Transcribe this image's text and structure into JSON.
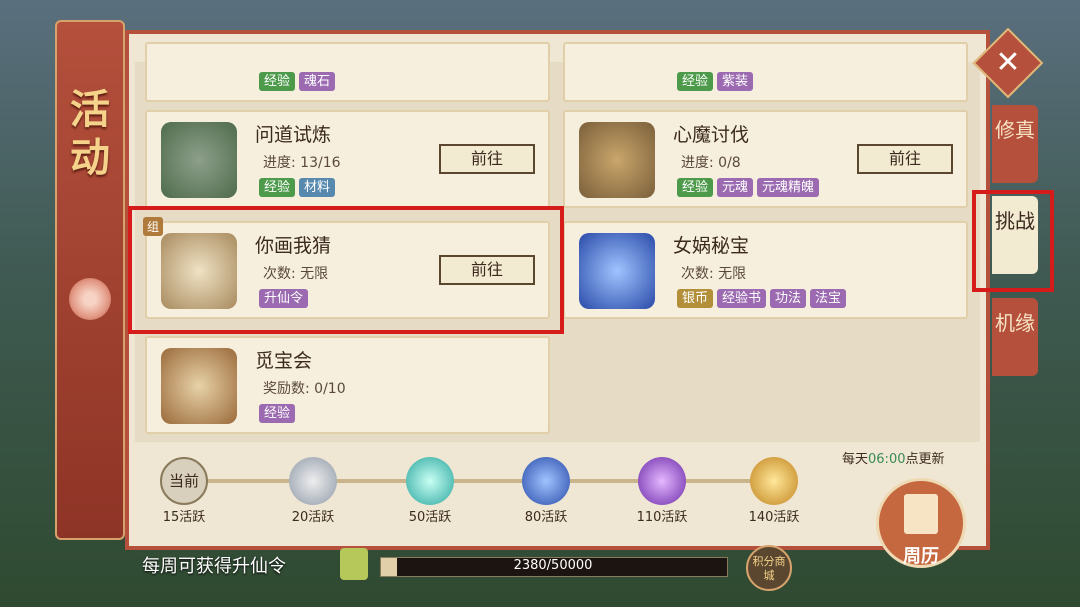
{
  "banner": {
    "title": "活动"
  },
  "right_tabs": [
    {
      "label": "修真",
      "active": false
    },
    {
      "label": "挑战",
      "active": true
    },
    {
      "label": "机缘",
      "active": false
    }
  ],
  "cards": [
    {
      "tags": [
        {
          "text": "经验",
          "color": "green"
        },
        {
          "text": "魂石",
          "color": "purple"
        }
      ]
    },
    {
      "tags": [
        {
          "text": "经验",
          "color": "green"
        },
        {
          "text": "紫装",
          "color": "purple"
        }
      ]
    },
    {
      "name": "问道试炼",
      "sub": "进度: 13/16",
      "button": "前往",
      "tags": [
        {
          "text": "经验",
          "color": "green"
        },
        {
          "text": "材料",
          "color": "blue"
        }
      ]
    },
    {
      "name": "心魔讨伐",
      "sub": "进度: 0/8",
      "button": "前往",
      "tags": [
        {
          "text": "经验",
          "color": "green"
        },
        {
          "text": "元魂",
          "color": "purple"
        },
        {
          "text": "元魂精魄",
          "color": "purple"
        }
      ]
    },
    {
      "name": "你画我猜",
      "sub": "次数: 无限",
      "button": "前往",
      "badge": "组",
      "tags": [
        {
          "text": "升仙令",
          "color": "purple"
        }
      ]
    },
    {
      "name": "女娲秘宝",
      "sub": "次数: 无限",
      "tags": [
        {
          "text": "银币",
          "color": "gold"
        },
        {
          "text": "经验书",
          "color": "purple"
        },
        {
          "text": "功法",
          "color": "purple"
        },
        {
          "text": "法宝",
          "color": "purple"
        }
      ]
    },
    {
      "name": "觅宝会",
      "sub": "奖励数: 0/10",
      "tags": [
        {
          "text": "经验",
          "color": "purple"
        }
      ]
    }
  ],
  "progress": {
    "current_label": "当前",
    "nodes": [
      "15活跃",
      "20活跃",
      "50活跃",
      "80活跃",
      "110活跃",
      "140活跃"
    ]
  },
  "update": {
    "prefix": "每天",
    "time": "06:00",
    "suffix": "点更新"
  },
  "weekly": {
    "label": "每周可获得升仙令",
    "value": 2380,
    "max": 50000,
    "text": "2380/50000"
  },
  "shop_button": "积分商城",
  "calendar_button": "周历"
}
